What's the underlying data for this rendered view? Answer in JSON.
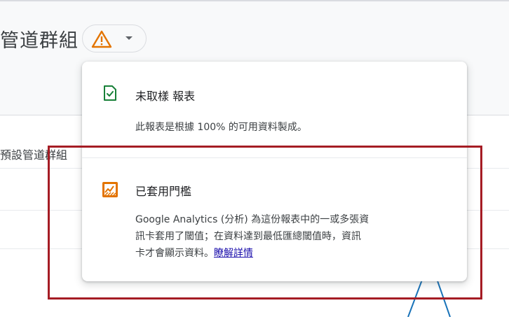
{
  "header": {
    "title": "管道群組"
  },
  "table": {
    "first_row_text": "預設管道群組"
  },
  "popover": {
    "sampling": {
      "icon": "check-document-icon",
      "title": "未取樣 報表",
      "description": "此報表是根據 100% 的可用資料製成。"
    },
    "threshold": {
      "icon": "threshold-chart-icon",
      "title": "已套用門檻",
      "description_line1": "Google Analytics (分析) 為這份報表中的一或多張資",
      "description_line2": "訊卡套用了閾值；在資料達到最低匯總閾值時，資訊",
      "description_line3": "卡才會顯示資料。",
      "link_label": "瞭解詳情"
    }
  },
  "colors": {
    "warning": "#e37400",
    "success": "#188038",
    "link": "#1a0dab",
    "highlight": "#a51c24",
    "chart_line": "#1a73b8"
  }
}
